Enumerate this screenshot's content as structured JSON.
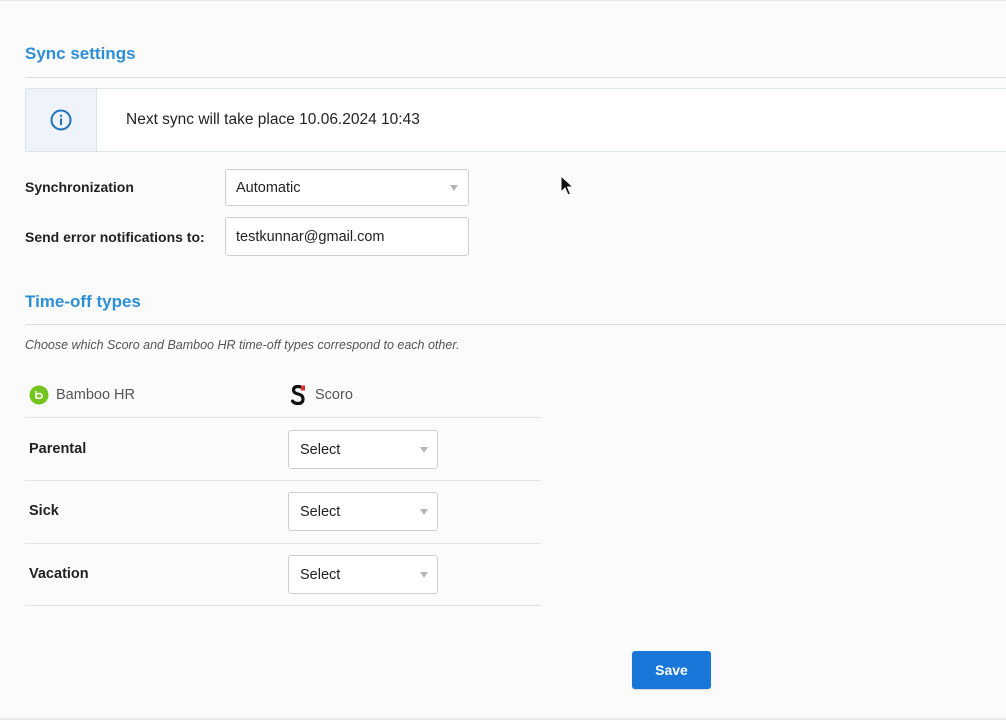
{
  "sync_settings": {
    "title": "Sync settings",
    "info_message": "Next sync will take place 10.06.2024 10:43",
    "synchronization_label": "Synchronization",
    "synchronization_value": "Automatic",
    "error_notifications_label": "Send error notifications to:",
    "error_notifications_value": "testkunnar@gmail.com"
  },
  "time_off": {
    "title": "Time-off types",
    "hint": "Choose which Scoro and Bamboo HR time-off types correspond to each other.",
    "col_bamboo": "Bamboo HR",
    "col_scoro": "Scoro",
    "rows": [
      {
        "label": "Parental",
        "select": "Select"
      },
      {
        "label": "Sick",
        "select": "Select"
      },
      {
        "label": "Vacation",
        "select": "Select"
      }
    ]
  },
  "save_label": "Save",
  "colors": {
    "accent": "#2d8fd5",
    "button": "#1877d8",
    "bamboo_green": "#73c41d"
  }
}
